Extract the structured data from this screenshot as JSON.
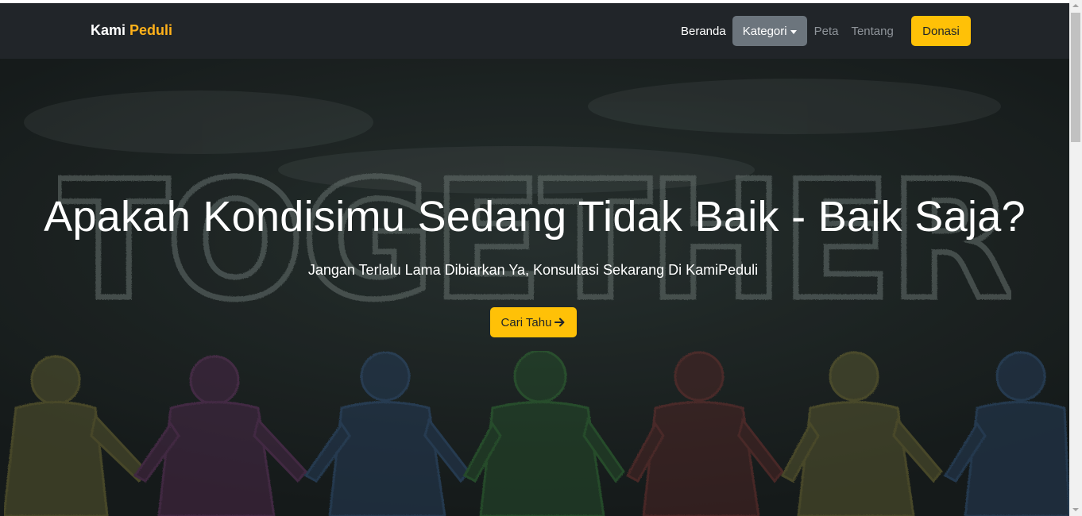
{
  "navbar": {
    "brand_part1": "Kami",
    "brand_part2": "Peduli",
    "links": [
      {
        "label": "Beranda"
      },
      {
        "label": "Kategori"
      },
      {
        "label": "Peta"
      },
      {
        "label": "Tentang"
      }
    ],
    "donate_label": "Donasi"
  },
  "hero": {
    "background_word": "TOGETHER",
    "title": "Apakah Kondisimu Sedang Tidak Baik - Baik Saja?",
    "subtitle": "Jangan Terlalu Lama Dibiarkan Ya, Konsultasi Sekarang Di KamiPeduli",
    "cta_label": "Cari Tahu",
    "cta_icon": "arrow-right-icon"
  },
  "colors": {
    "navbar_bg": "#212529",
    "accent": "#ffc107",
    "brand_accent": "#ffb11a",
    "dropdown_bg": "#6c757d"
  }
}
